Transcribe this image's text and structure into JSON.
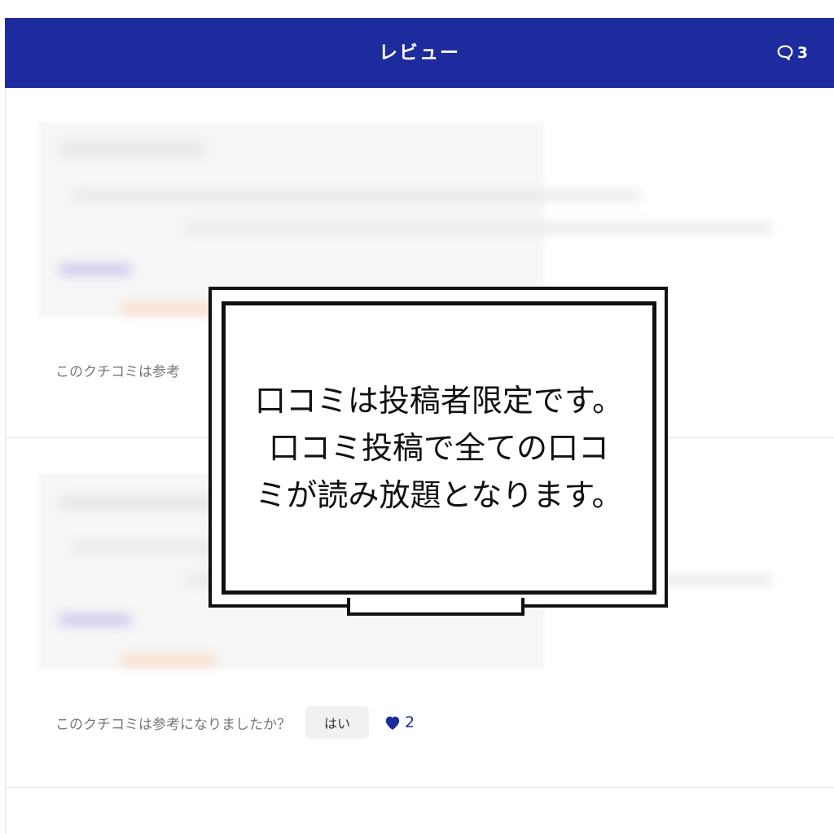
{
  "header": {
    "title": "レビュー",
    "comment_count": "3",
    "background_color": "#1d2b9e"
  },
  "reviews": [
    {
      "helpful_question": "このクチコミは参考",
      "yes_label": "",
      "likes": ""
    },
    {
      "helpful_question": "このクチコミは参考になりましたか？",
      "yes_label": "はい",
      "likes": "2"
    }
  ],
  "overlay": {
    "lines": [
      "口コミは投稿者限定です。",
      "口コミ投稿で全ての口コ",
      "ミが読み放題となります。"
    ]
  },
  "icons": {
    "comment": "speech-bubble-icon",
    "like": "heart-icon"
  }
}
